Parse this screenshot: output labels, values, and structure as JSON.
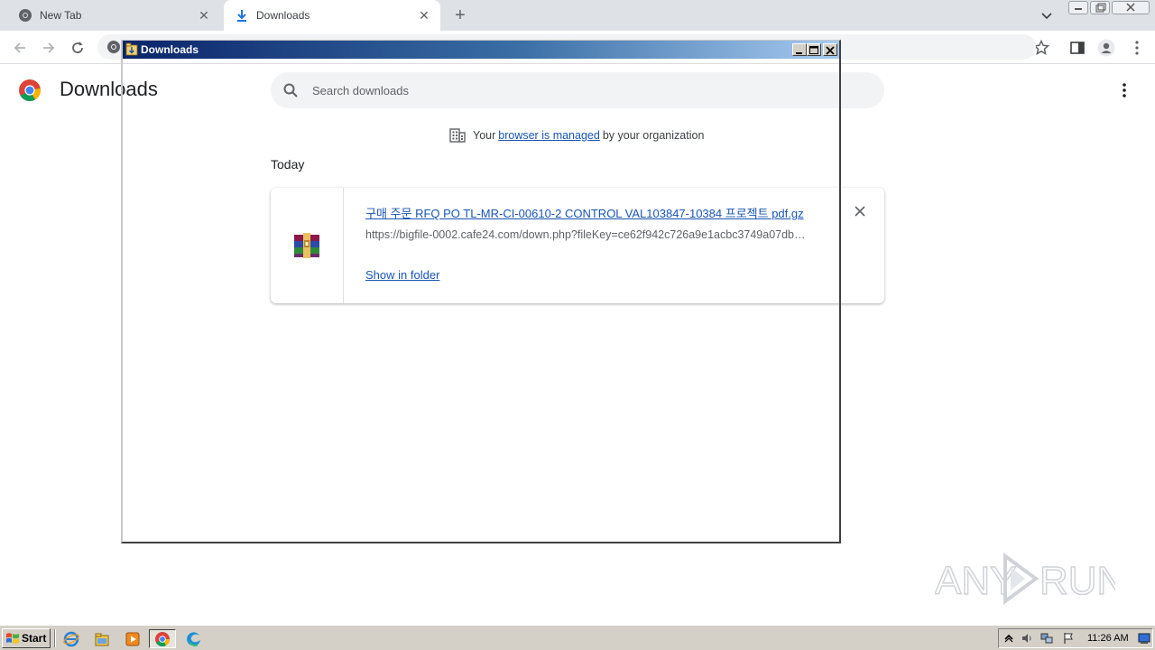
{
  "tabs": [
    {
      "label": "New Tab",
      "active": false
    },
    {
      "label": "Downloads",
      "active": true
    }
  ],
  "page": {
    "title": "Downloads",
    "search_placeholder": "Search downloads",
    "managed_prefix": "Your",
    "managed_link": "browser is managed",
    "managed_suffix": "by your organization",
    "section": "Today"
  },
  "download": {
    "file_name": "구매 주문 RFQ PO TL-MR-CI-00610-2 CONTROL VAL103847-10384 프로젝트 pdf.gz",
    "url": "https://bigfile-0002.cafe24.com/down.php?fileKey=ce62f942c726a9e1acbc3749a07db…",
    "show_in_folder": "Show in folder"
  },
  "overlay_window": {
    "title": "Downloads"
  },
  "taskbar": {
    "start_label": "Start",
    "clock": "11:26 AM"
  },
  "watermark": "ANY RUN",
  "colors": {
    "link": "#1a55b3",
    "titlebar_start": "#0a246a",
    "titlebar_end": "#a6caf0",
    "taskbar": "#d4d0c8"
  }
}
